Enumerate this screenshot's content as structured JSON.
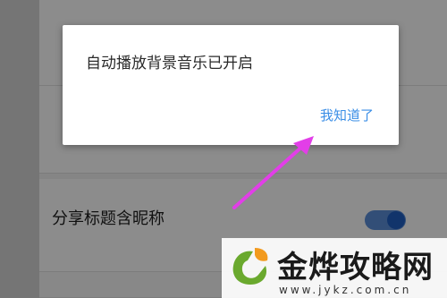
{
  "dialog": {
    "message": "自动播放背景音乐已开启",
    "ok_label": "我知道了"
  },
  "settings": {
    "rows": [
      {
        "title": "",
        "description": ""
      },
      {
        "title": "",
        "description": ""
      },
      {
        "title": "分享标题含昵称",
        "description": "",
        "toggle_on": true
      },
      {
        "title": "",
        "description": ""
      }
    ]
  },
  "watermark": {
    "brand": "金烨攻略网",
    "url": "www.jykz.com.cn"
  },
  "colors": {
    "link": "#3a8ee6",
    "toggle": "#1f5fc4",
    "arrow": "#e23ee8",
    "logo_green": "#6aa92e",
    "logo_orange": "#f29a1e"
  }
}
